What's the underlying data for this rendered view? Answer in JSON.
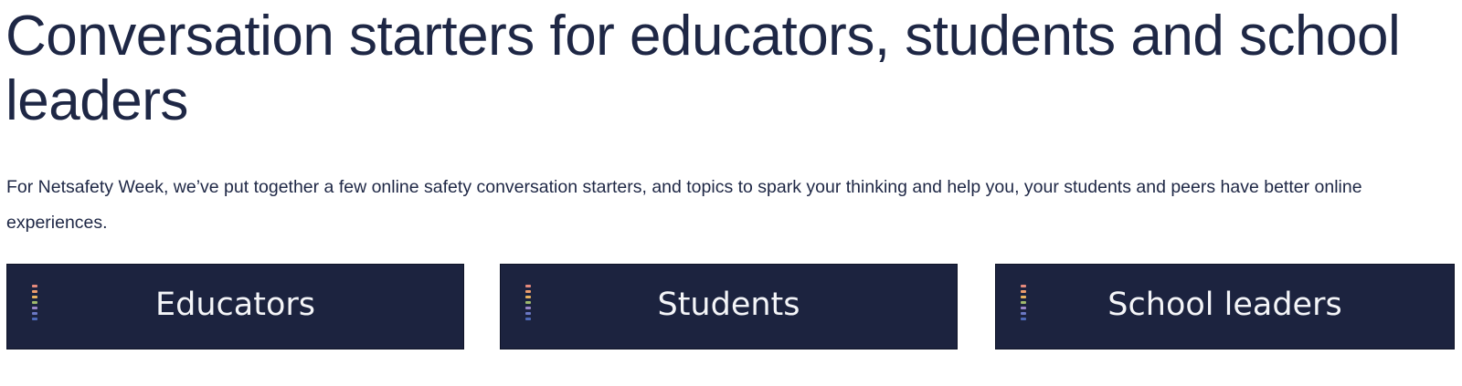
{
  "page": {
    "title": "Conversation starters for educators, students and school leaders",
    "intro": "For Netsafety Week, we’ve put together a few online safety conversation starters, and topics to spark your thinking and help you, your students and peers have better online experiences."
  },
  "cards": [
    {
      "label": "Educators"
    },
    {
      "label": "Students"
    },
    {
      "label": "School leaders"
    }
  ],
  "colors": {
    "heading": "#1e2745",
    "card_background": "#1c233f",
    "card_text": "#f4f5f8",
    "stripe": [
      "#e58a7c",
      "#ec9c6d",
      "#e8b35e",
      "#9fb96c",
      "#9a86c8",
      "#6b78c4",
      "#4e6ab8"
    ]
  }
}
